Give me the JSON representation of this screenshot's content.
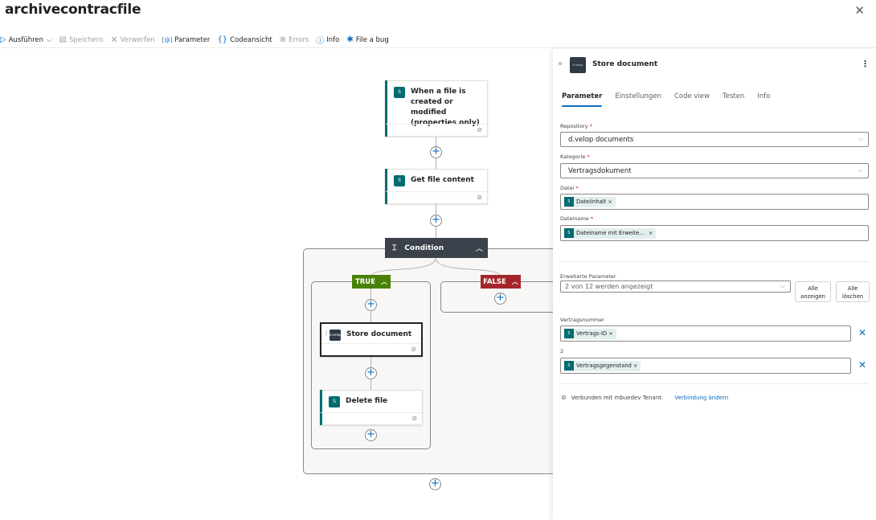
{
  "app": {
    "title": "archivecontracfile",
    "more": "···",
    "close": "✕"
  },
  "toolbar": {
    "items": [
      {
        "label": "Ausführen",
        "icon": "play-icon",
        "glyph": "▷",
        "suffix": "⌵",
        "enabled": true
      },
      {
        "label": "Speichern",
        "icon": "save-icon",
        "glyph": "🖫",
        "enabled": false
      },
      {
        "label": "Verwerfen",
        "icon": "discard-icon",
        "glyph": "✕",
        "enabled": false
      },
      {
        "label": "Parameter",
        "icon": "parameter-icon",
        "glyph": "[@]",
        "enabled": true
      },
      {
        "label": "Codeansicht",
        "icon": "code-icon",
        "glyph": "{}",
        "enabled": true
      },
      {
        "label": "Errors",
        "icon": "error-icon",
        "glyph": "⊗",
        "enabled": false
      },
      {
        "label": "Info",
        "icon": "info-icon",
        "glyph": "ⓘ",
        "enabled": true
      },
      {
        "label": "File a bug",
        "icon": "bug-icon",
        "glyph": "🐞",
        "enabled": true
      }
    ]
  },
  "flow": {
    "trigger": {
      "title": "When a file is created or modified (properties only)",
      "icon": "sharepoint-icon"
    },
    "get_file": {
      "title": "Get file content",
      "icon": "sharepoint-icon"
    },
    "condition": {
      "title": "Condition",
      "icon": "condition-icon"
    },
    "true_branch": {
      "label": "TRUE"
    },
    "false_branch": {
      "label": "FALSE"
    },
    "store_document": {
      "title": "Store document",
      "icon": "dvelop-icon",
      "icon_text": "d.velop"
    },
    "delete_file": {
      "title": "Delete file",
      "icon": "sharepoint-icon"
    },
    "plus": "+"
  },
  "panel": {
    "title": "Store document",
    "icon_text": "d.velop",
    "tabs": [
      {
        "label": "Parameter",
        "active": true
      },
      {
        "label": "Einstellungen",
        "active": false
      },
      {
        "label": "Code view",
        "active": false
      },
      {
        "label": "Testen",
        "active": false
      },
      {
        "label": "Info",
        "active": false
      }
    ],
    "fields": {
      "repository": {
        "label": "Repository",
        "required": "*",
        "value": "d.velop documents"
      },
      "kategorie": {
        "label": "Kategorie",
        "required": "*",
        "value": "Vertragsdokument"
      },
      "datei": {
        "label": "Datei",
        "required": "*",
        "token": "Dateiinhalt"
      },
      "dateiname": {
        "label": "Dateiname",
        "required": "*",
        "token": "Dateiname mit Erweite..."
      }
    },
    "advanced": {
      "label": "Erweiterte Parameter",
      "value": "2 von 12 werden angezeigt",
      "show_all": "Alle anzeigen",
      "show_all_l1": "Alle",
      "show_all_l2": "anzeigen",
      "clear_all_l1": "Alle",
      "clear_all_l2": "löschen"
    },
    "extra_fields": [
      {
        "label": "Vertragsnummer",
        "token": "Vertrags-ID"
      },
      {
        "label": "2",
        "token": "Vertragsgegenstand"
      }
    ],
    "connection": {
      "text": "Verbunden mit mbuedev Tenant.",
      "link": "Verbindung ändern"
    },
    "token_remove": "×",
    "remove_field": "✕"
  }
}
